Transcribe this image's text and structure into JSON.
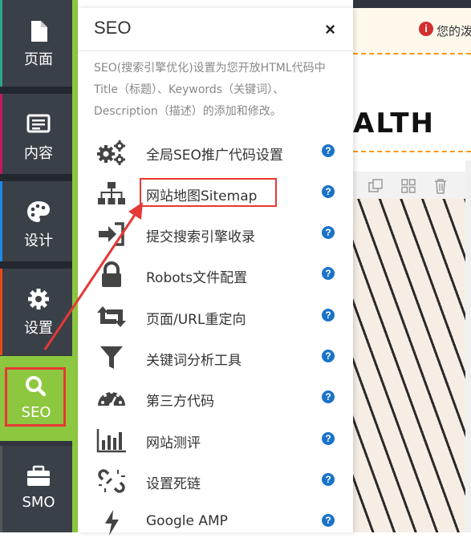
{
  "sidebar": {
    "items": [
      {
        "label": "页面",
        "icon": "file-icon"
      },
      {
        "label": "内容",
        "icon": "list-icon"
      },
      {
        "label": "设计",
        "icon": "palette-icon"
      },
      {
        "label": "设置",
        "icon": "gear-icon"
      },
      {
        "label": "SEO",
        "icon": "search-icon",
        "active": true
      },
      {
        "label": "SMO",
        "icon": "briefcase-icon"
      }
    ],
    "accent_color": "#8dc63f"
  },
  "panel": {
    "title": "SEO",
    "close": "×",
    "description": "SEO(搜索引擎优化)设置为您开放HTML代码中Title（标题）、Keywords（关键词）、Description（描述）的添加和修改。",
    "items": [
      {
        "label": "全局SEO推广代码设置",
        "icon": "gears-icon"
      },
      {
        "label": "网站地图Sitemap",
        "icon": "sitemap-icon"
      },
      {
        "label": "提交搜索引擎收录",
        "icon": "sign-in-icon"
      },
      {
        "label": "Robots文件配置",
        "icon": "lock-icon"
      },
      {
        "label": "页面/URL重定向",
        "icon": "retweet-icon"
      },
      {
        "label": "关键词分析工具",
        "icon": "filter-icon"
      },
      {
        "label": "第三方代码",
        "icon": "dashboard-icon"
      },
      {
        "label": "网站测评",
        "icon": "bar-chart-icon"
      },
      {
        "label": "设置死链",
        "icon": "broken-link-icon"
      },
      {
        "label": "Google AMP",
        "icon": "bolt-icon"
      }
    ],
    "help_glyph": "?",
    "help_color": "#1a73c8"
  },
  "preview": {
    "notice": "您的泼",
    "notice_icon": "i",
    "hero": "ALTH"
  }
}
